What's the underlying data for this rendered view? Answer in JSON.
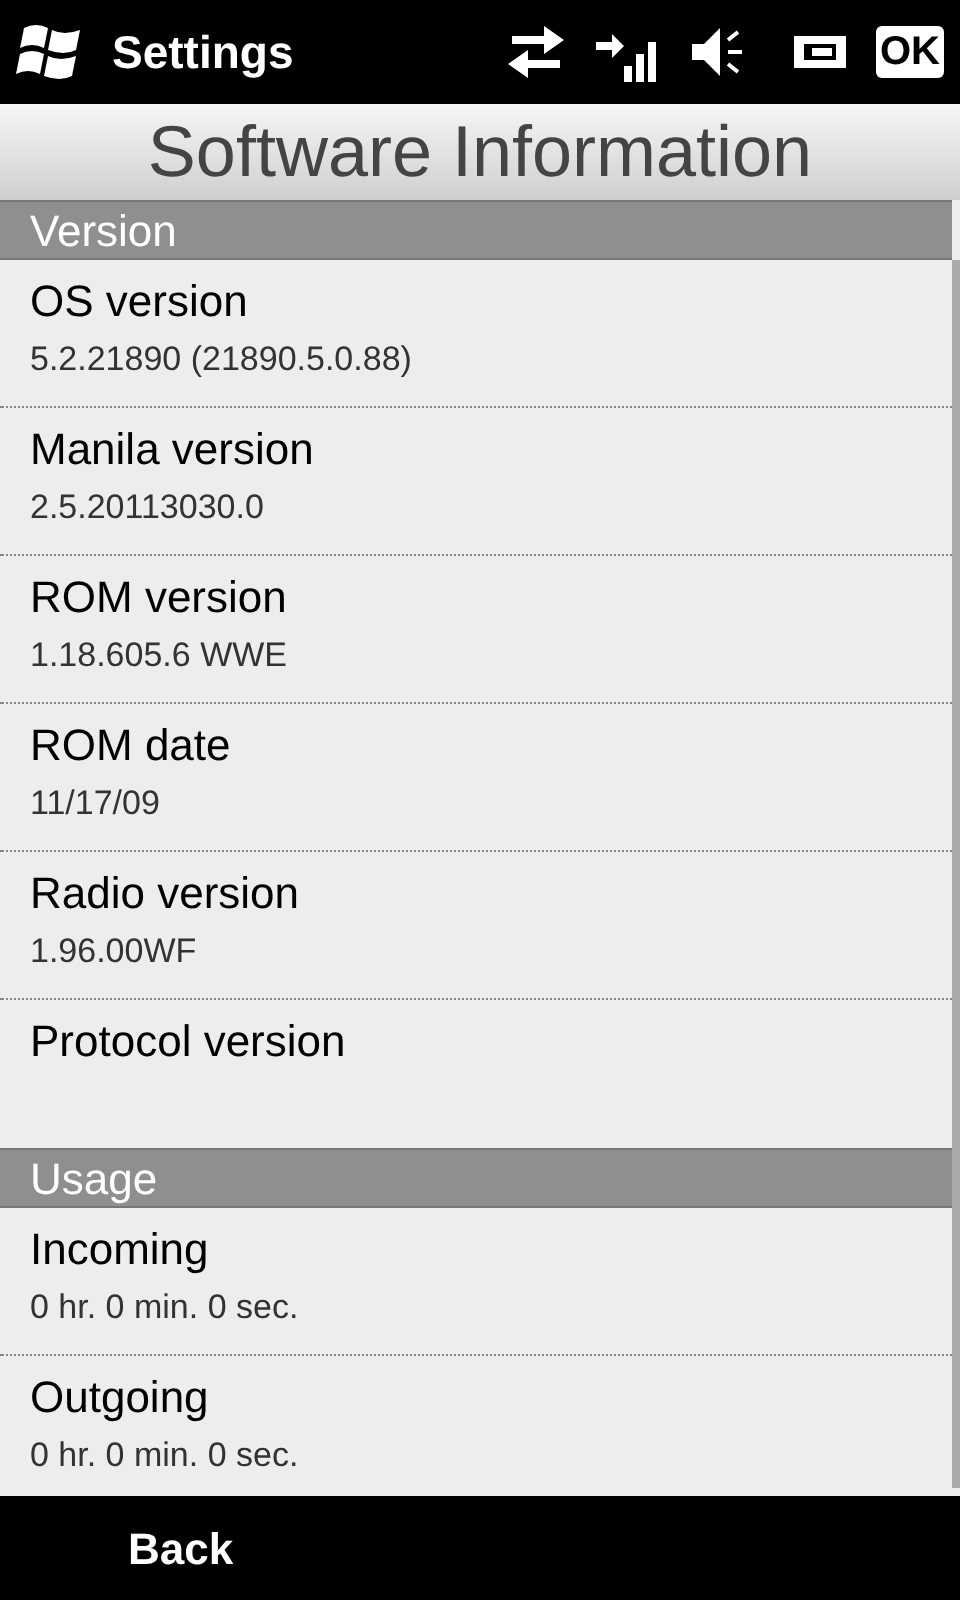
{
  "top_bar": {
    "title": "Settings",
    "ok_button": "OK"
  },
  "page_title": "Software Information",
  "sections": [
    {
      "header": "Version",
      "items": [
        {
          "label": "OS version",
          "value": "5.2.21890 (21890.5.0.88)"
        },
        {
          "label": "Manila version",
          "value": "2.5.20113030.0"
        },
        {
          "label": "ROM version",
          "value": "1.18.605.6 WWE"
        },
        {
          "label": "ROM date",
          "value": "11/17/09"
        },
        {
          "label": "Radio version",
          "value": "1.96.00WF"
        },
        {
          "label": "Protocol version"
        }
      ]
    },
    {
      "header": "Usage",
      "items": [
        {
          "label": "Incoming",
          "value": "0 hr. 0 min. 0 sec."
        },
        {
          "label": "Outgoing",
          "value": "0 hr. 0 min. 0 sec."
        }
      ]
    }
  ],
  "bottom_bar": {
    "left_button": "Back"
  }
}
